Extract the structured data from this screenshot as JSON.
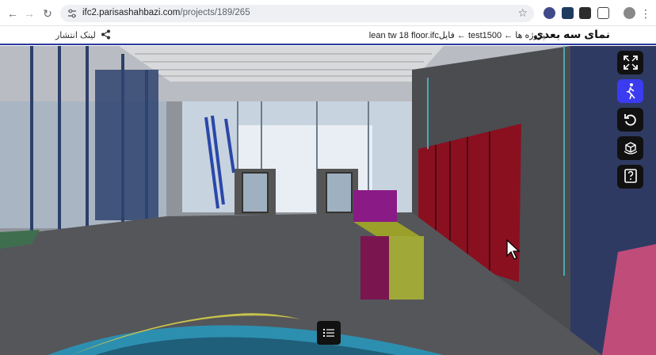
{
  "browser": {
    "url_host": "ifc2.parisashahbazi.com",
    "url_path": "/projects/189/265",
    "back_icon": "arrow-left-icon",
    "forward_icon": "arrow-right-icon",
    "reload_icon": "reload-icon"
  },
  "header": {
    "title": "نمای سه بعدی",
    "breadcrumb": "پروژه ها ← test1500 ← فایلlean tw 18 floor.ifc",
    "share_label": "لینک انتشار"
  },
  "toolbar": {
    "tools": [
      {
        "name": "fullscreen-icon",
        "active": false
      },
      {
        "name": "walk-mode-icon",
        "active": true
      },
      {
        "name": "reset-view-icon",
        "active": false
      },
      {
        "name": "cube-view-icon",
        "active": false
      },
      {
        "name": "help-icon",
        "active": false
      }
    ]
  },
  "colors": {
    "accent": "#3b3bf0",
    "header_border": "#2a3b9a"
  }
}
